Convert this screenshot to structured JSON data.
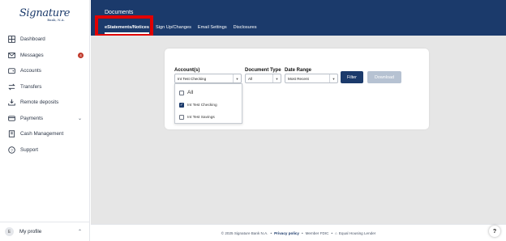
{
  "logo": {
    "name": "Signature",
    "sub": "Bank, N.A."
  },
  "sidebar": {
    "items": [
      {
        "label": "Dashboard",
        "icon": "dashboard-icon"
      },
      {
        "label": "Messages",
        "icon": "envelope-icon",
        "badge": "4"
      },
      {
        "label": "Accounts",
        "icon": "wallet-icon"
      },
      {
        "label": "Transfers",
        "icon": "transfer-arrows-icon"
      },
      {
        "label": "Remote deposits",
        "icon": "download-tray-icon"
      },
      {
        "label": "Payments",
        "icon": "credit-card-icon"
      },
      {
        "label": "Cash Management",
        "icon": "building-icon"
      },
      {
        "label": "Support",
        "icon": "question-circle-icon"
      }
    ],
    "profile": {
      "avatar": "E",
      "label": "My profile"
    }
  },
  "header": {
    "title": "Documents",
    "tabs": [
      "eStatements/Notices",
      "Sign Up/Changes",
      "Email Settings",
      "Disclosures"
    ]
  },
  "form": {
    "accounts_label": "Account(s)",
    "accounts_value": "Int Test Checking",
    "doc_type_label": "Document Type",
    "doc_type_value": "All",
    "date_range_label": "Date Range",
    "date_range_value": "Most Recent",
    "filter_label": "Filter",
    "download_label": "Download"
  },
  "dropdown": {
    "options": [
      {
        "label": "All",
        "checked": false
      },
      {
        "label": "Int Test Checking",
        "checked": true
      },
      {
        "label": "Int Test Savings",
        "checked": false
      }
    ]
  },
  "footer": {
    "copyright": "© 2025 Signature Bank N.A.",
    "privacy": "Privacy policy",
    "fdic": "Member FDIC",
    "ehl": "Equal Housing Lender"
  },
  "help_label": "?",
  "colors": {
    "brand": "#1b3a6b",
    "highlight": "#e10000",
    "badge": "#c0392b"
  }
}
